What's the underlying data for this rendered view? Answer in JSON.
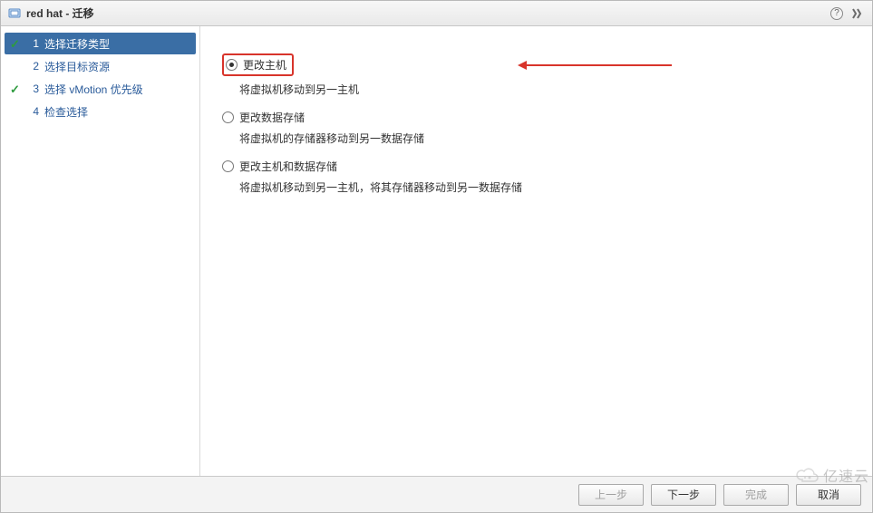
{
  "titlebar": {
    "title": "red hat - 迁移"
  },
  "sidebar": {
    "steps": [
      {
        "num": "1",
        "label": "选择迁移类型",
        "checked": true,
        "active": true
      },
      {
        "num": "2",
        "label": "选择目标资源",
        "checked": false,
        "active": false
      },
      {
        "num": "3",
        "label": "选择 vMotion 优先级",
        "checked": true,
        "active": false
      },
      {
        "num": "4",
        "label": "检查选择",
        "checked": false,
        "active": false
      }
    ]
  },
  "main": {
    "options": [
      {
        "label": "更改主机",
        "desc": "将虚拟机移动到另一主机",
        "selected": true,
        "highlighted": true
      },
      {
        "label": "更改数据存储",
        "desc": "将虚拟机的存储器移动到另一数据存储",
        "selected": false,
        "highlighted": false
      },
      {
        "label": "更改主机和数据存储",
        "desc": "将虚拟机移动到另一主机，将其存储器移动到另一数据存储",
        "selected": false,
        "highlighted": false
      }
    ]
  },
  "footer": {
    "back": "上一步",
    "next": "下一步",
    "finish": "完成",
    "cancel": "取消"
  },
  "watermark": {
    "text": "亿速云"
  },
  "colors": {
    "accent_red": "#d8342b",
    "selection_blue": "#3a6ea5",
    "check_green": "#2e9b3f"
  }
}
